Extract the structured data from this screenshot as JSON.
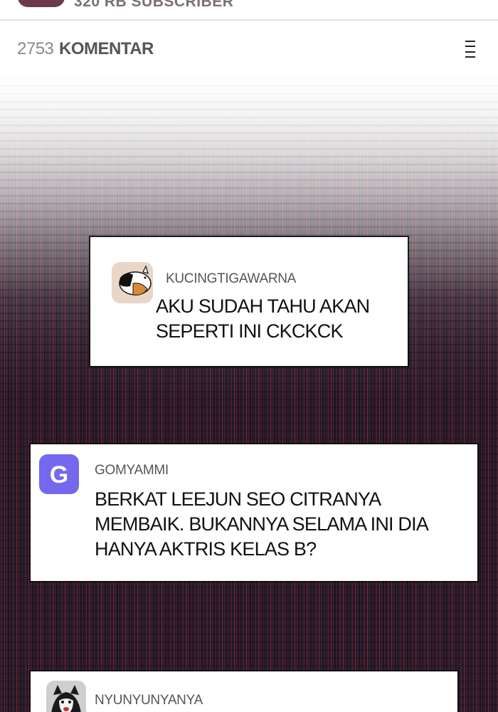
{
  "channel": {
    "subscriber_text": "320 RB SUBSCRIBER"
  },
  "comments_header": {
    "count": "2753",
    "label": "KOMENTAR",
    "menu_icon": "menu-icon"
  },
  "comments": [
    {
      "username": "KUCINGTIGAWARNA",
      "avatar": "cat-avatar",
      "text": "AKU SUDAH TAHU AKAN SEPERTI INI CKCKCK"
    },
    {
      "username": "GOMYAMMI",
      "avatar_letter": "G",
      "avatar_color": "#7468ee",
      "text": "BERKAT LEEJUN SEO CITRANYA MEMBAIK. BUKANNYA SELAMA INI DIA HANYA AKTRIS KELAS B?"
    },
    {
      "username": "NYUNYUNYANYA",
      "avatar": "dog-avatar",
      "text": ""
    }
  ]
}
